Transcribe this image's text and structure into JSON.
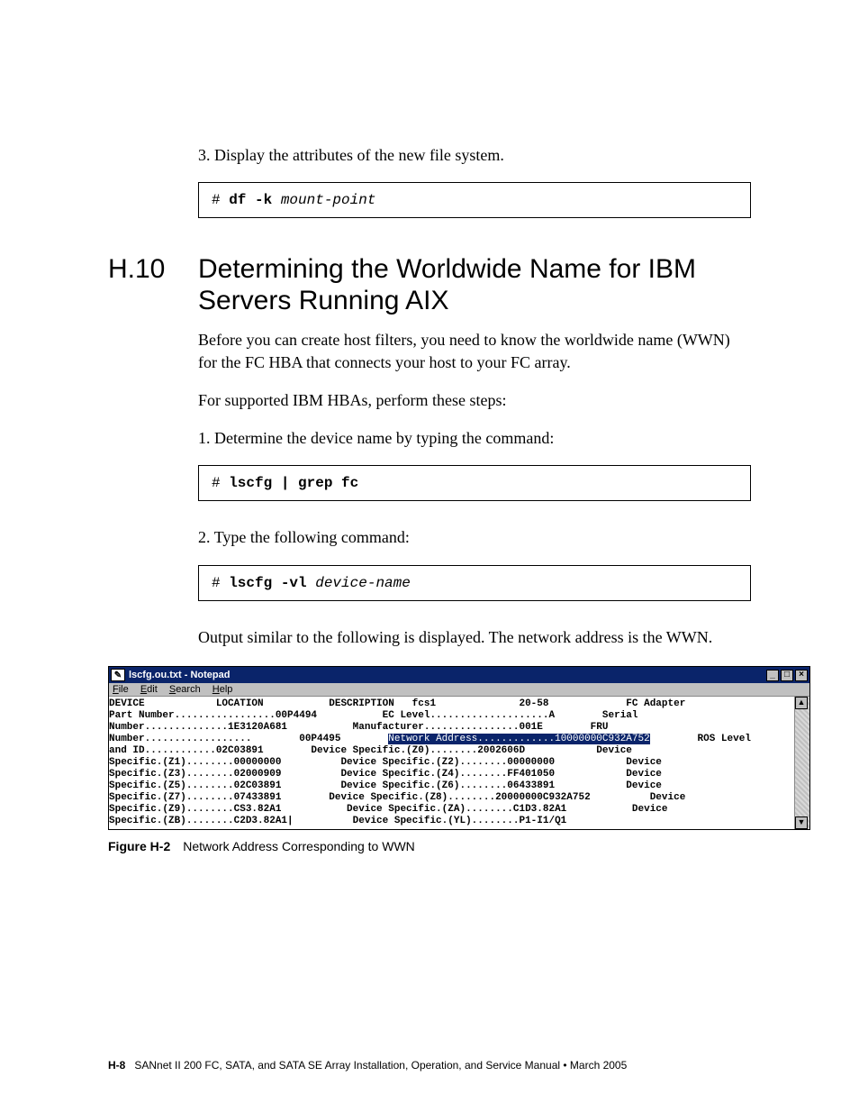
{
  "step3": {
    "num": "3.",
    "text": "Display the attributes of the new file system.",
    "cmd_prompt": "# ",
    "cmd_bold": "df -k",
    "cmd_italic": " mount-point"
  },
  "section": {
    "num": "H.10",
    "title": "Determining the Worldwide Name for IBM Servers Running AIX"
  },
  "para1": "Before you can create host filters, you need to know the worldwide name (WWN) for the FC HBA that connects your host to your FC array.",
  "para2": "For supported IBM HBAs, perform these steps:",
  "step1": {
    "num": "1.",
    "text": "Determine the device name by typing the command:",
    "cmd_prompt": "# ",
    "cmd_bold": "lscfg | grep fc"
  },
  "step2": {
    "num": "2.",
    "text": "Type the following command:",
    "cmd_prompt": "# ",
    "cmd_bold": "lscfg -vl",
    "cmd_italic": " device-name"
  },
  "para3": "Output similar to the following is displayed. The network address is the WWN.",
  "notepad": {
    "title": "lscfg.ou.txt - Notepad",
    "menu": {
      "file": "File",
      "edit": "Edit",
      "search": "Search",
      "help": "Help"
    },
    "line1a": "DEVICE            LOCATION           DESCRIPTION   fcs1              20-58             FC Adapter",
    "line2": "Part Number.................00P4494           EC Level....................A        Serial",
    "line3": "Number..............1E3120A681           Manufacturer................001E        FRU",
    "line4a": "Number..................        00P4495        ",
    "line4_hl": "Network Address.............10000000C932A752",
    "line4b": "        ROS Level",
    "line5": "and ID............02C03891        Device Specific.(Z0)........2002606D            Device",
    "line6": "Specific.(Z1)........00000000          Device Specific.(Z2)........00000000            Device",
    "line7": "Specific.(Z3)........02000909          Device Specific.(Z4)........FF401050            Device",
    "line8": "Specific.(Z5)........02C03891          Device Specific.(Z6)........06433891            Device",
    "line9": "Specific.(Z7)........07433891        Device Specific.(Z8)........20000000C932A752          Device",
    "line10": "Specific.(Z9)........CS3.82A1           Device Specific.(ZA)........C1D3.82A1           Device",
    "line11": "Specific.(ZB)........C2D3.82A1|          Device Specific.(YL)........P1-I1/Q1"
  },
  "figure": {
    "label": "Figure H-2",
    "caption": "Network Address Corresponding to WWN"
  },
  "footer": {
    "page": "H-8",
    "text": "SANnet II 200 FC, SATA, and SATA SE Array Installation, Operation, and Service Manual  •  March 2005"
  }
}
